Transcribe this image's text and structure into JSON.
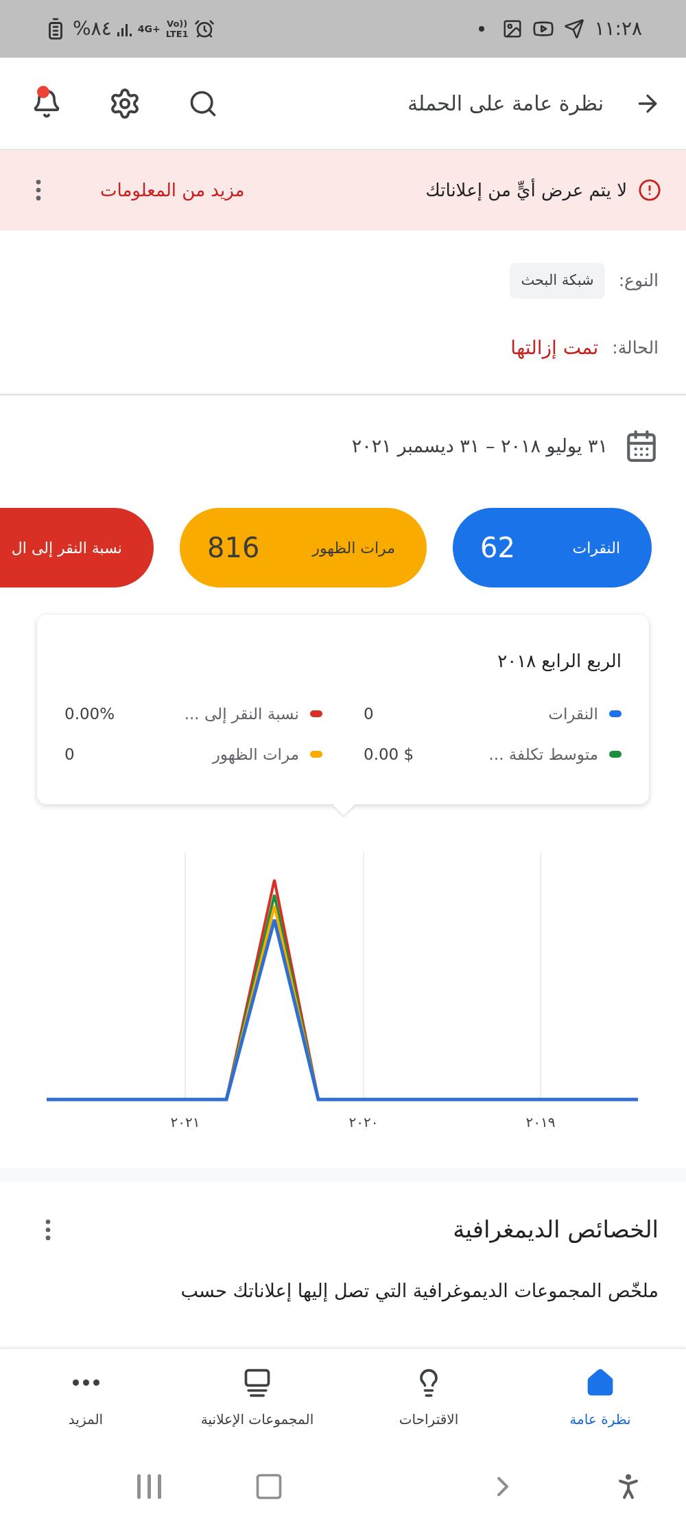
{
  "status_bar": {
    "time": "١١:٢٨",
    "battery": "%٨٤",
    "network": "4G+",
    "volte": "Vo))",
    "lte": "LTE1"
  },
  "app_bar": {
    "title": "نظرة عامة على الحملة",
    "notification_badge": true
  },
  "alert": {
    "message": "لا يتم عرض أيٍّ من إعلاناتك",
    "link": "مزيد من المعلومات"
  },
  "details": [
    {
      "label": "النوع:",
      "value": "شبكة البحث",
      "kind": "chip"
    },
    {
      "label": "الحالة:",
      "value": "تمت إزالتها",
      "kind": "status"
    }
  ],
  "date_range": "٣١ يوليو ٢٠١٨ – ٣١ ديسمبر ٢٠٢١",
  "metrics": [
    {
      "label": "النقرات",
      "value": "62",
      "color": "#1a73e8"
    },
    {
      "label": "مرات الظهور",
      "value": "816",
      "color": "#f9ab00"
    },
    {
      "label": "نسبة النقر إلى ال",
      "color": "#d93025"
    }
  ],
  "tooltip": {
    "title": "الربع الرابع ٢٠١٨",
    "items": [
      {
        "label": "النقرات",
        "value": "0",
        "color": "#1a73e8"
      },
      {
        "label": "نسبة النقر إلى ...",
        "value": "0.00%",
        "color": "#d93025"
      },
      {
        "label": "متوسط تكلفة ...",
        "value": "0.00 $",
        "color": "#1e8e3e"
      },
      {
        "label": "مرات الظهور",
        "value": "0",
        "color": "#f9ab00"
      }
    ]
  },
  "chart": {
    "x_labels": [
      "٢٠١٩",
      "٢٠٢٠",
      "٢٠٢١"
    ]
  },
  "demographics": {
    "title": "الخصائص الديمغرافية",
    "description": "ملخّص المجموعات الديموغرافية التي تصل إليها إعلاناتك حسب"
  },
  "bottom_nav": [
    {
      "label": "نظرة عامة",
      "kind": "home",
      "selected": true
    },
    {
      "label": "الاقتراحات",
      "kind": "bulb",
      "selected": false
    },
    {
      "label": "المجموعات الإعلانية",
      "kind": "groups",
      "selected": false
    },
    {
      "label": "المزيد",
      "kind": "more",
      "selected": false
    }
  ]
}
